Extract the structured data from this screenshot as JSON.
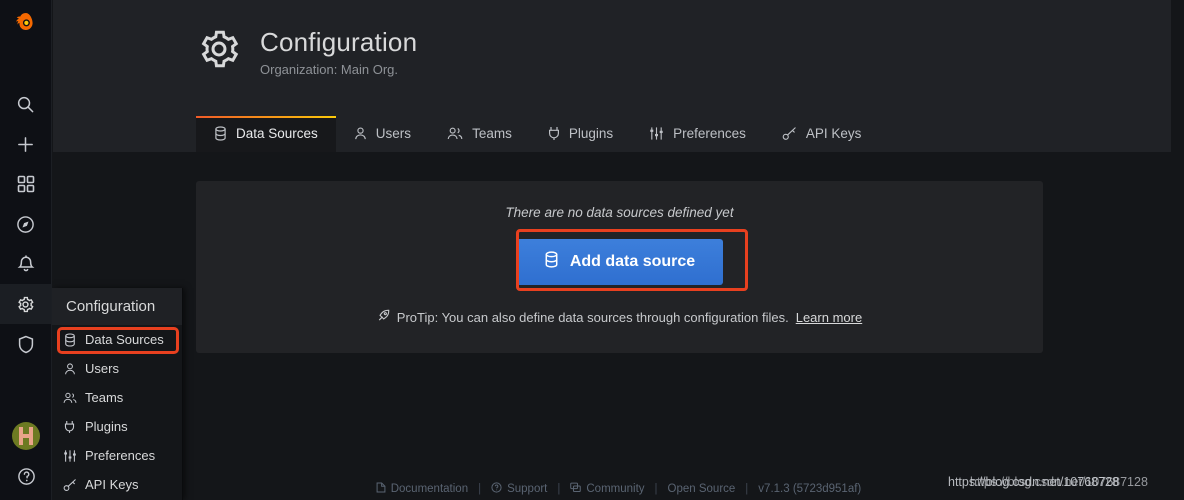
{
  "sidebar": {
    "logo": "grafana-logo",
    "items": [
      {
        "icon": "search-icon",
        "name": "search"
      },
      {
        "icon": "plus-icon",
        "name": "create"
      },
      {
        "icon": "dashboards-icon",
        "name": "dashboards"
      },
      {
        "icon": "compass-icon",
        "name": "explore"
      },
      {
        "icon": "bell-icon",
        "name": "alerting"
      },
      {
        "icon": "gear-icon",
        "name": "configuration",
        "active": true
      },
      {
        "icon": "shield-icon",
        "name": "server-admin"
      }
    ],
    "bottom": [
      {
        "icon": "avatar",
        "name": "user-profile"
      },
      {
        "icon": "help-icon",
        "name": "help"
      }
    ]
  },
  "flyout": {
    "title": "Configuration",
    "items": [
      {
        "label": "Data Sources",
        "icon": "database-icon",
        "highlighted": true
      },
      {
        "label": "Users",
        "icon": "user-icon"
      },
      {
        "label": "Teams",
        "icon": "users-icon"
      },
      {
        "label": "Plugins",
        "icon": "plug-icon"
      },
      {
        "label": "Preferences",
        "icon": "sliders-icon"
      },
      {
        "label": "API Keys",
        "icon": "key-icon"
      }
    ]
  },
  "header": {
    "icon": "gear-icon",
    "title": "Configuration",
    "subtitle": "Organization: Main Org."
  },
  "tabs": [
    {
      "label": "Data Sources",
      "icon": "database-icon",
      "active": true
    },
    {
      "label": "Users",
      "icon": "user-icon"
    },
    {
      "label": "Teams",
      "icon": "users-icon"
    },
    {
      "label": "Plugins",
      "icon": "plug-icon"
    },
    {
      "label": "Preferences",
      "icon": "sliders-icon"
    },
    {
      "label": "API Keys",
      "icon": "key-icon"
    }
  ],
  "main": {
    "empty_message": "There are no data sources defined yet",
    "add_button": "Add data source",
    "add_button_icon": "database-icon",
    "protip_icon": "rocket-icon",
    "protip_text": "ProTip: You can also define data sources through configuration files.",
    "protip_link": "Learn more"
  },
  "footer": {
    "links": [
      {
        "label": "Documentation",
        "icon": "document-icon"
      },
      {
        "label": "Support",
        "icon": "question-circle-icon"
      },
      {
        "label": "Community",
        "icon": "comments-icon"
      },
      {
        "label": "Open Source",
        "icon": ""
      }
    ],
    "version": "v7.1.3 (5723d951af)",
    "separator": "|"
  },
  "status_bar": {
    "url_a": "https://blog.csdn.net/10768728",
    "url_b": "https://blog.csdn.net/107687128"
  },
  "colors": {
    "highlight": "#e8401f",
    "accent_button": "#3274d9",
    "tab_accent_start": "#f05a28",
    "tab_accent_end": "#fbca0a",
    "page_bg": "#141619",
    "panel_bg": "#222326"
  }
}
